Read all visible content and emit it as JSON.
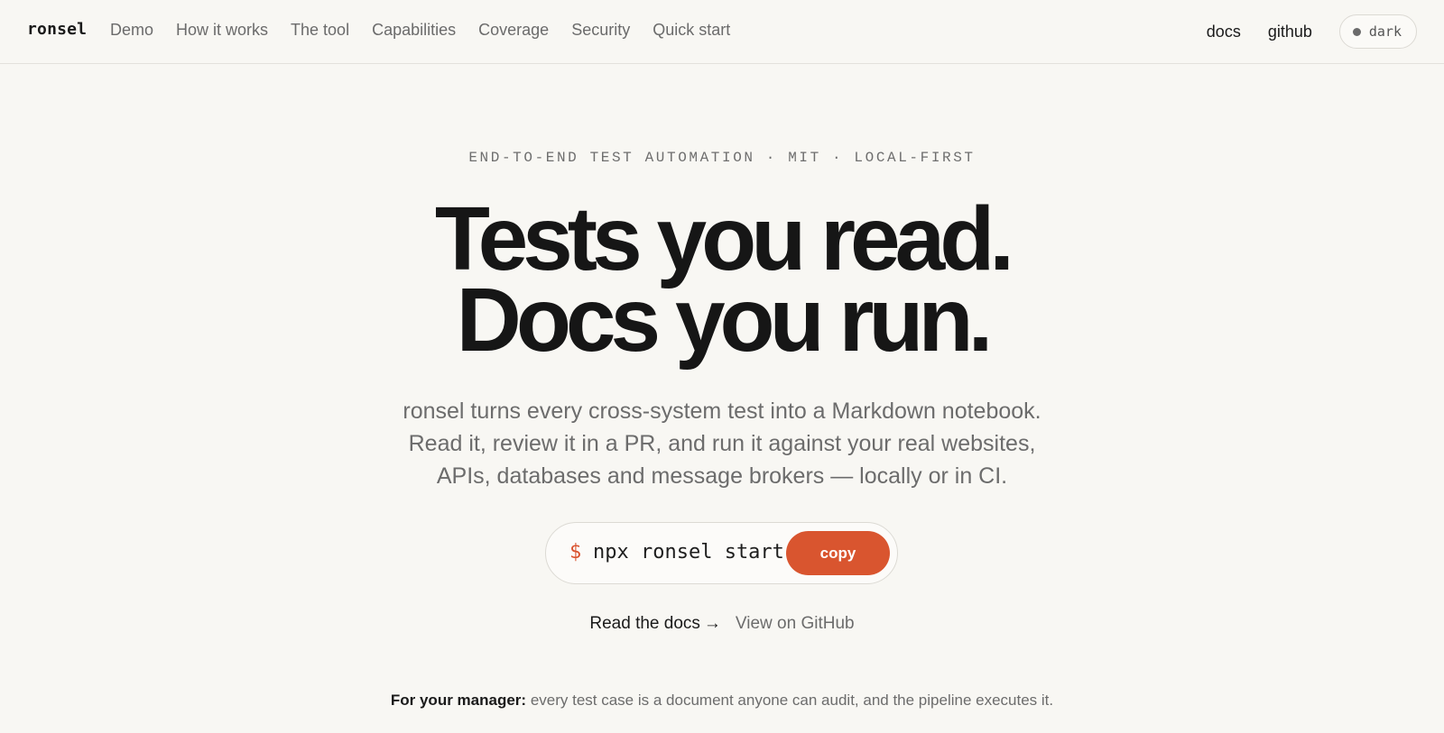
{
  "brand": "ronsel",
  "nav": {
    "links": [
      "Demo",
      "How it works",
      "The tool",
      "Capabilities",
      "Coverage",
      "Security",
      "Quick start"
    ],
    "right": {
      "docs": "docs",
      "github": "github",
      "theme": "dark"
    }
  },
  "hero": {
    "eyebrow": "END-TO-END TEST AUTOMATION · MIT · LOCAL-FIRST",
    "headline_line1": "Tests you read.",
    "headline_line2": "Docs you run.",
    "sub_line1": "ronsel turns every cross-system test into a Markdown notebook.",
    "sub_line2": "Read it, review it in a PR, and run it against your real websites,",
    "sub_line3": "APIs, databases and message brokers — locally or in CI."
  },
  "command": {
    "prompt": "$",
    "text": "npx ronsel start",
    "copy_label": "copy"
  },
  "links": {
    "docs": "Read the docs",
    "arrow": "→",
    "github": "View on GitHub"
  },
  "manager": {
    "label": "For your manager:",
    "text": "every test case is a document anyone can audit, and the pipeline executes it."
  },
  "colors": {
    "accent": "#d9552f",
    "background": "#f8f7f3",
    "text": "#1a1a1a",
    "muted": "#6c6c6c"
  },
  "icons": {
    "theme_toggle": "dot-icon",
    "docs_arrow": "arrow-right-icon"
  }
}
